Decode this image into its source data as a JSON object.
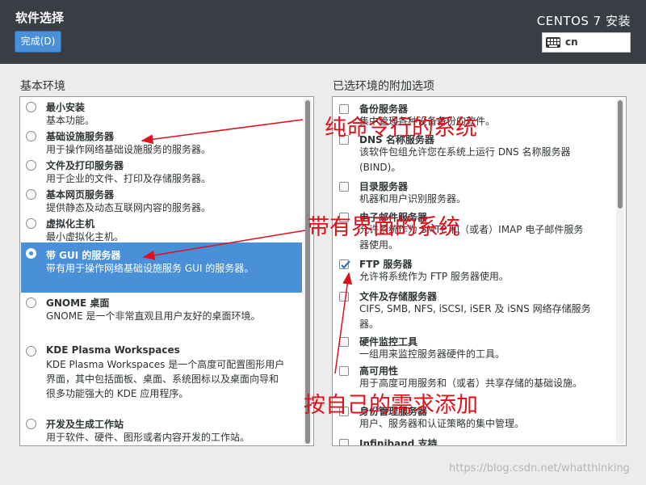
{
  "header": {
    "title": "软件选择",
    "done_label": "完成(D)",
    "product": "CENTOS 7 安装",
    "keyboard_layout": "cn"
  },
  "base_env": {
    "heading": "基本环境",
    "items": [
      {
        "title": "最小安装",
        "desc": [
          "基本功能。"
        ]
      },
      {
        "title": "基础设施服务器",
        "desc": [
          "用于操作网络基础设施服务的服务器。"
        ]
      },
      {
        "title": "文件及打印服务器",
        "desc": [
          "用于企业的文件、打印及存储服务器。"
        ]
      },
      {
        "title": "基本网页服务器",
        "desc": [
          "提供静态及动态互联网内容的服务器。"
        ]
      },
      {
        "title": "虚拟化主机",
        "desc": [
          "最小虚拟化主机。"
        ]
      },
      {
        "title": "带 GUI 的服务器",
        "desc": [
          "带有用于操作网络基础设施服务 GUI 的服务器。"
        ]
      },
      {
        "title": "GNOME 桌面",
        "desc": [
          "GNOME 是一个非常直观且用户友好的桌面环境。"
        ]
      },
      {
        "title": "KDE Plasma Workspaces",
        "desc": [
          "KDE Plasma Workspaces 是一个高度可配置图形用户",
          "界面，其中包括面板、桌面、系统图标以及桌面向导和",
          "很多功能强大的 KDE 应用程序。"
        ]
      },
      {
        "title": "开发及生成工作站",
        "desc": [
          "用于软件、硬件、图形或者内容开发的工作站。"
        ]
      }
    ],
    "selected_index": 5
  },
  "addons": {
    "heading": "已选环境的附加选项",
    "items": [
      {
        "title": "备份服务器",
        "desc": [
          "集中管理各种设备备份的软件。"
        ],
        "checked": false
      },
      {
        "title": "DNS 名称服务器",
        "desc": [
          "该软件包组允许您在系统上运行 DNS 名称服务器",
          "(BIND)。"
        ],
        "checked": false
      },
      {
        "title": "目录服务器",
        "desc": [
          "机器和用户识别服务器。"
        ],
        "checked": false
      },
      {
        "title": "电子邮件服务器",
        "desc": [
          "允许系统作为 SMTP 和（或者）IMAP 电子邮件服务",
          "器使用。"
        ],
        "checked": false
      },
      {
        "title": "FTP 服务器",
        "desc": [
          "允许将系统作为 FTP 服务器使用。"
        ],
        "checked": true
      },
      {
        "title": "文件及存储服务器",
        "desc": [
          "CIFS, SMB, NFS, iSCSI, iSER 及 iSNS 网络存储服务",
          "器。"
        ],
        "checked": false
      },
      {
        "title": "硬件监控工具",
        "desc": [
          "一组用来监控服务器硬件的工具。"
        ],
        "checked": false
      },
      {
        "title": "高可用性",
        "desc": [
          "用于高度可用服务和（或者）共享存储的基础设施。"
        ],
        "checked": false
      },
      {
        "title": "身份管理服务器",
        "desc": [
          "用户、服务器和认证策略的集中管理。"
        ],
        "checked": false
      },
      {
        "title": "Infiniband 支持",
        "desc": [],
        "checked": false
      }
    ]
  },
  "annotations": {
    "pure_system": "纯命令行的系统",
    "gui_system": "带有界面的系统",
    "add_as_needed": "按自己的需求添加",
    "color": "#e0101a"
  },
  "watermark": "https://blog.csdn.net/whatthinking"
}
